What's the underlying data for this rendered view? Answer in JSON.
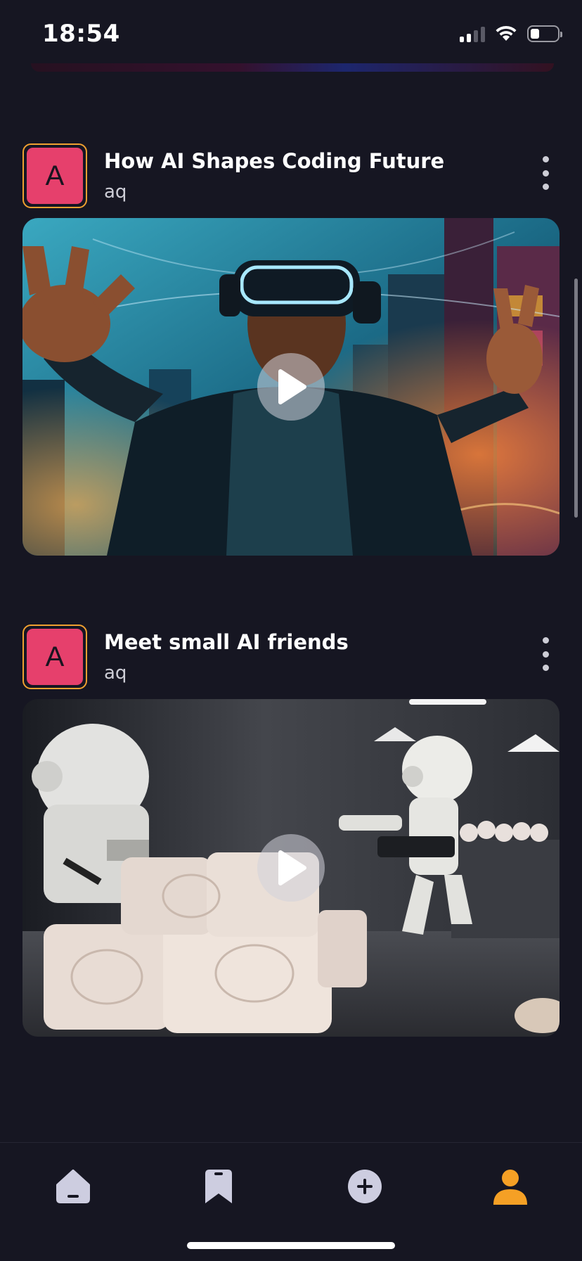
{
  "status_bar": {
    "time": "18:54"
  },
  "feed": {
    "posts": [
      {
        "avatar_letter": "A",
        "title": "How AI Shapes Coding Future",
        "author": "aq",
        "media": "video-thumbnail-vr-headset-person-neon-city",
        "has_play_icon": true
      },
      {
        "avatar_letter": "A",
        "title": "Meet small AI friends",
        "author": "aq",
        "media": "video-thumbnail-toy-robots-workshop",
        "has_play_icon": true
      }
    ]
  },
  "bottom_nav": {
    "items": [
      {
        "icon": "home-icon",
        "active": false
      },
      {
        "icon": "bookmark-icon",
        "active": false
      },
      {
        "icon": "plus-circle-icon",
        "active": false
      },
      {
        "icon": "profile-icon",
        "active": true
      }
    ]
  },
  "colors": {
    "background": "#161622",
    "accent": "#f5a025",
    "avatar": "#e6406c",
    "inactive_icon": "#cdcde0"
  }
}
